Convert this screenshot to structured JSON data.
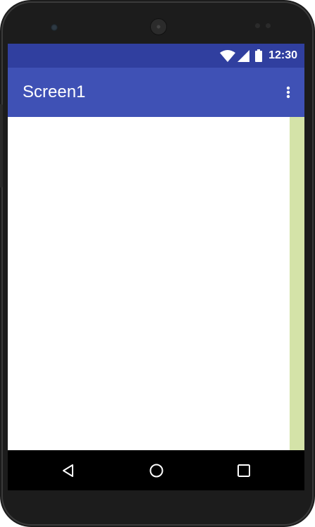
{
  "status_bar": {
    "time": "12:30",
    "icons": [
      "wifi-icon",
      "signal-icon",
      "battery-icon"
    ]
  },
  "app_bar": {
    "title": "Screen1",
    "overflow_icon": "more-vert-icon"
  },
  "nav_bar": {
    "icons": [
      "back-icon",
      "home-icon",
      "recents-icon"
    ]
  },
  "colors": {
    "status_bar": "#303f9f",
    "app_bar": "#3f51b5",
    "content_background": "#ffffff",
    "scroll_strip": "#d4e3a8",
    "nav_bar": "#000000",
    "device_body": "#1c1c1c"
  }
}
